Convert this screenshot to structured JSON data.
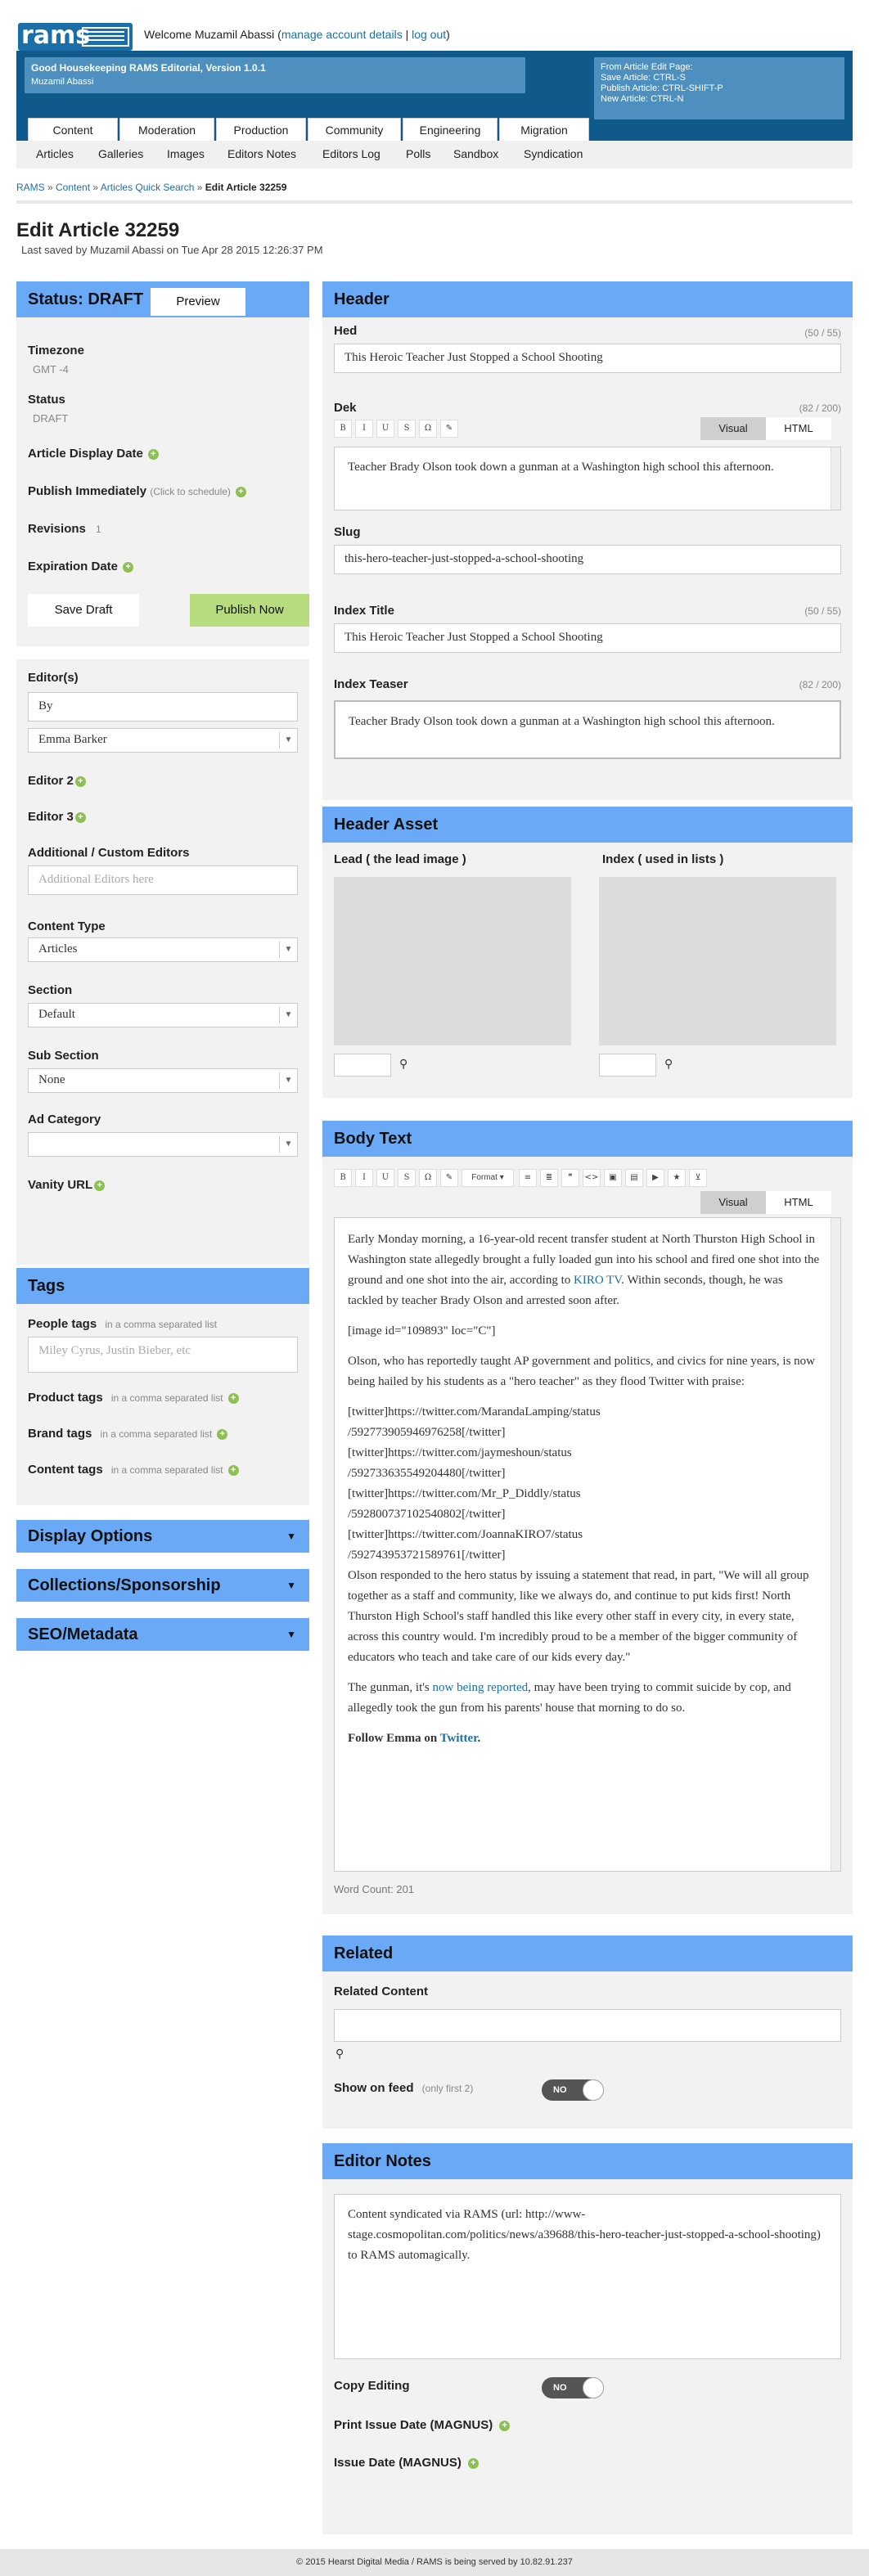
{
  "app": {
    "logo": "rams",
    "welcome_prefix": "Welcome Muzamil Abassi",
    "welcome_open": "(",
    "manage_link": "manage account details",
    "sep": " | ",
    "logout_link": "log out",
    "welcome_close": ")"
  },
  "banner": {
    "title": "Good Housekeeping RAMS Editorial, Version 1.0.1",
    "user": "Muzamil Abassi",
    "shortcuts": [
      "From Article Edit Page:",
      "Save Article: CTRL-S",
      "Publish Article: CTRL-SHIFT-P",
      "New Article: CTRL-N"
    ]
  },
  "nav_primary": [
    "Content",
    "Moderation",
    "Production",
    "Community",
    "Engineering",
    "Migration"
  ],
  "nav_secondary": [
    "Articles",
    "Galleries",
    "Images",
    "Editors Notes",
    "Editors Log",
    "Polls",
    "Sandbox",
    "Syndication"
  ],
  "breadcrumb": {
    "items": [
      "RAMS",
      "Content",
      "Articles Quick Search"
    ],
    "sep": " » ",
    "current": "Edit Article 32259"
  },
  "page": {
    "title": "Edit Article 32259",
    "last_saved": "Last saved by Muzamil Abassi on Tue Apr 28 2015 12:26:37 PM"
  },
  "status_panel": {
    "status": "Status: DRAFT",
    "preview": "Preview",
    "timezone_label": "Timezone",
    "timezone_value": "GMT -4",
    "status_label": "Status",
    "status_value": "DRAFT",
    "display_date": "Article Display Date",
    "publish_immediately": "Publish Immediately",
    "click_to_schedule": "(Click to schedule)",
    "revisions_label": "Revisions",
    "revisions_value": "1",
    "expiration_date": "Expiration Date",
    "save_draft": "Save Draft",
    "publish_now": "Publish Now"
  },
  "editors_panel": {
    "editors_label": "Editor(s)",
    "by_value": "By",
    "editor_value": "Emma Barker",
    "editor2": "Editor 2",
    "editor3": "Editor 3",
    "additional_label": "Additional / Custom Editors",
    "additional_placeholder": "Additional Editors here",
    "content_type_label": "Content Type",
    "content_type_value": "Articles",
    "section_label": "Section",
    "section_value": "Default",
    "sub_section_label": "Sub Section",
    "sub_section_value": "None",
    "ad_category_label": "Ad Category",
    "ad_category_value": "",
    "vanity_url": "Vanity URL"
  },
  "tags_panel": {
    "title": "Tags",
    "people_label": "People tags",
    "people_hint": "in a comma separated list",
    "people_placeholder": "Miley Cyrus, Justin Bieber, etc",
    "product_label": "Product tags",
    "product_hint": "in a comma separated list",
    "brand_label": "Brand tags",
    "brand_hint": "in a comma separated list",
    "content_label": "Content tags",
    "content_hint": "in a comma separated list"
  },
  "collapsibles": [
    "Display Options",
    "Collections/Sponsorship",
    "SEO/Metadata"
  ],
  "header_panel": {
    "title": "Header",
    "hed_label": "Hed",
    "hed_count": "(50 / 55)",
    "hed_value": "This Heroic Teacher Just Stopped a School Shooting",
    "dek_label": "Dek",
    "dek_count": "(82 / 200)",
    "dek_value": "Teacher Brady Olson took down a gunman at a Washington high school this afternoon.",
    "slug_label": "Slug",
    "slug_value": "this-hero-teacher-just-stopped-a-school-shooting",
    "index_title_label": "Index Title",
    "index_title_count": "(50 / 55)",
    "index_title_value": "This Heroic Teacher Just Stopped a School Shooting",
    "index_teaser_label": "Index Teaser",
    "index_teaser_count": "(82 / 200)",
    "index_teaser_value": "Teacher Brady Olson took down a gunman at a Washington high school this afternoon.",
    "visual": "Visual",
    "html": "HTML",
    "mini_tools": [
      "B",
      "I",
      "U",
      "S",
      "Ω",
      "✎"
    ]
  },
  "asset_panel": {
    "title": "Header Asset",
    "lead_label": "Lead ( the lead image )",
    "index_label": "Index ( used in lists )"
  },
  "body_panel": {
    "title": "Body Text",
    "tools": [
      "B",
      "I",
      "U",
      "S",
      "Ω",
      "✎"
    ],
    "format": "Format",
    "tools2": [
      "≡",
      "≣",
      "❞",
      "<>",
      "▣",
      "▤",
      "▶",
      "★",
      "⊻"
    ],
    "visual": "Visual",
    "html": "HTML",
    "p1_a": "Early Monday morning, a 16-year-old recent transfer student at North Thurston High School in Washington state allegedly brought a fully loaded gun into his school and fired one shot into the ground and one shot into the air, according to ",
    "p1_link": "KIRO TV",
    "p1_b": ". Within seconds, though, he was tackled by teacher Brady Olson and arrested soon after.",
    "p2": "[image id=\"109893\" loc=\"C\"]",
    "p3": "Olson, who has reportedly taught AP government and politics, and civics for nine years, is now being hailed by his students as a \"hero teacher\" as they flood Twitter with praise:",
    "twitter_lines": [
      "[twitter]https://twitter.com/MarandaLamping/status",
      "/592773905946976258[/twitter]",
      "[twitter]https://twitter.com/jaymeshoun/status",
      "/592733635549204480[/twitter]",
      "[twitter]https://twitter.com/Mr_P_Diddly/status",
      "/592800737102540802[/twitter]",
      "[twitter]https://twitter.com/JoannaKIRO7/status",
      "/592743953721589761[/twitter]"
    ],
    "p4": "Olson responded to the hero status by issuing a statement that read, in part, \"We will all group together as a staff and community, like we always do, and continue to put kids first! North Thurston High School's staff handled this like every other staff in every city, in every state, across this country would. I'm incredibly proud to be a member of the bigger community of educators who teach and take care of our kids every day.\"",
    "p5_a": "The gunman, it's ",
    "p5_link": "now being reported",
    "p5_b": ", may have been trying to commit suicide by cop, and allegedly took the gun from his parents' house that morning to do so.",
    "p6_a": "Follow Emma on ",
    "p6_link": "Twitter",
    "p6_b": ".",
    "word_count": "Word Count: 201"
  },
  "related_panel": {
    "title": "Related",
    "content_label": "Related Content",
    "feed_label": "Show on feed",
    "feed_hint": "(only first 2)",
    "feed_toggle": "NO"
  },
  "notes_panel": {
    "title": "Editor Notes",
    "note": "Content syndicated via RAMS (url: http://www-stage.cosmopolitan.com/politics/news/a39688/this-hero-teacher-just-stopped-a-school-shooting) to RAMS automagically.",
    "copy_editing": "Copy Editing",
    "copy_toggle": "NO",
    "print_issue": "Print Issue Date (MAGNUS)",
    "issue_date": "Issue Date (MAGNUS)"
  },
  "footer": "© 2015 Hearst Digital Media / RAMS is being served by 10.82.91.237",
  "colors": {
    "accent": "#6aa9f5",
    "banner": "#0f5a8a",
    "green": "#b7dc7d",
    "link": "#1a6fa8"
  }
}
